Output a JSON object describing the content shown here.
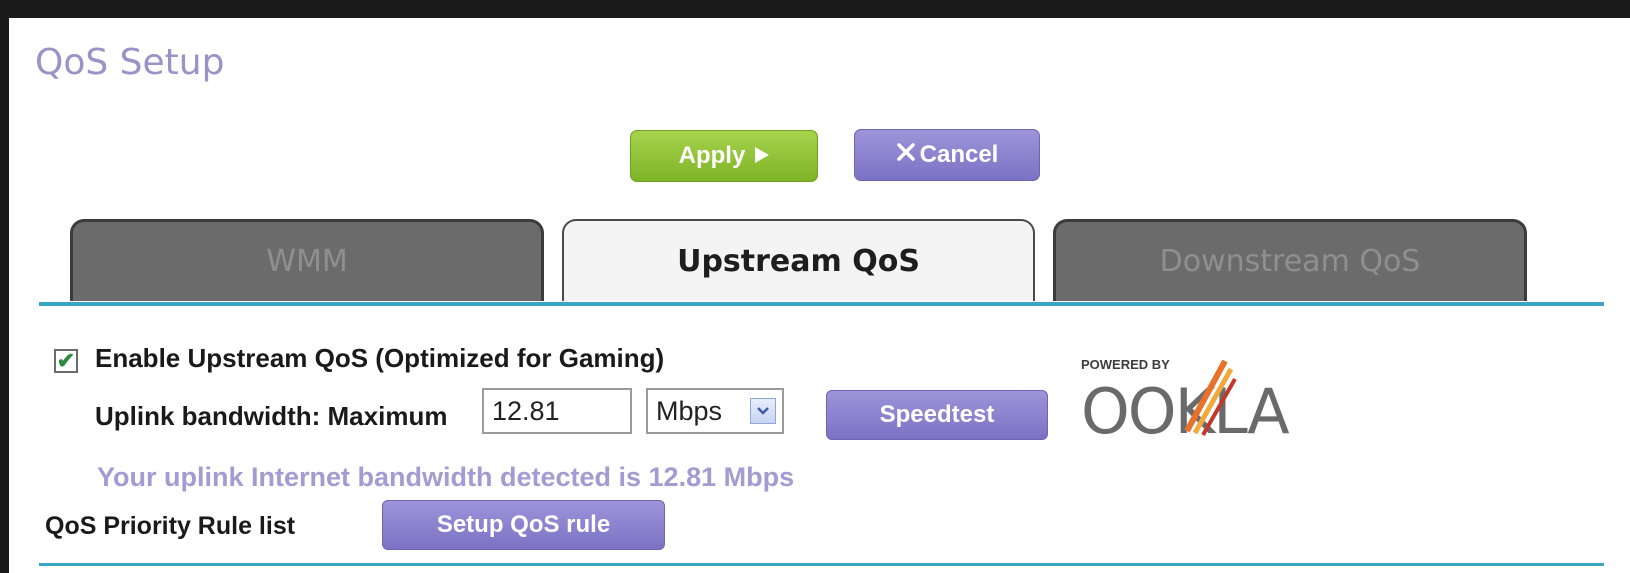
{
  "page": {
    "title": "QoS Setup"
  },
  "actions": {
    "apply_label": "Apply",
    "apply_icon": "play-triangle-icon",
    "cancel_label": "Cancel",
    "cancel_icon": "x-icon"
  },
  "tabs": [
    {
      "label": "WMM",
      "active": false
    },
    {
      "label": "Upstream QoS",
      "active": true
    },
    {
      "label": "Downstream QoS",
      "active": false
    }
  ],
  "upstream": {
    "enable_checked": true,
    "enable_label": "Enable Upstream QoS (Optimized for Gaming)",
    "uplink_label": "Uplink bandwidth: Maximum",
    "bandwidth_value": "12.81",
    "unit_selected": "Mbps",
    "speedtest_label": "Speedtest",
    "detected_text": "Your uplink Internet bandwidth detected is 12.81 Mbps"
  },
  "ookla": {
    "powered_by": "POWERED BY",
    "brand": "OOKLA"
  },
  "rules": {
    "label": "QoS Priority Rule list",
    "setup_button_label": "Setup QoS rule"
  },
  "colors": {
    "accent_line": "#3aa6c6",
    "apply_green": "#8cc23a",
    "button_purple": "#8a80cf",
    "title_purple": "#9a93c8"
  }
}
